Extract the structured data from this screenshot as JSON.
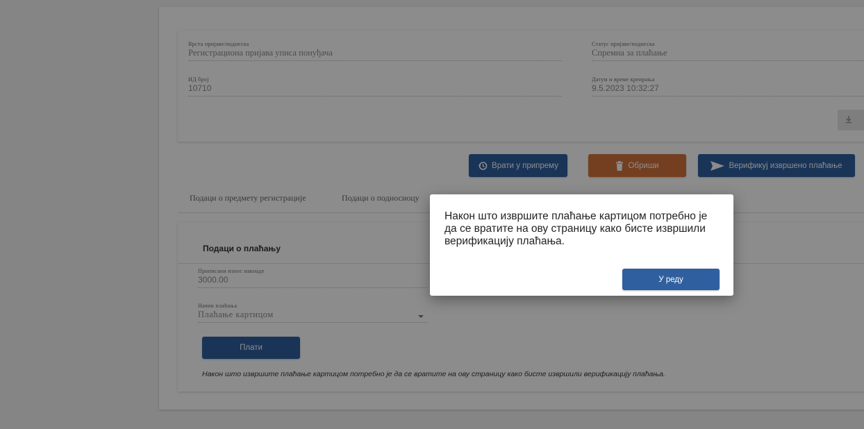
{
  "submission": {
    "type_label": "Врста пријаве/поднеска",
    "type_value": "Регистрациона пријава уписа понуђача",
    "status_label": "Статус пријаве/поднеска",
    "status_value": "Спремна за плаћање",
    "id_label": "ИД број",
    "id_value": "10710",
    "created_label": "Датум и време креирања",
    "created_value": "9.5.2023 10:32:27"
  },
  "actions": {
    "return_label": "Врати у припрему",
    "delete_label": "Обриши",
    "verify_label": "Верификуј извршено плаћање"
  },
  "tabs": [
    {
      "label": "Подаци о предмету регистрације"
    },
    {
      "label": "Подаци о подносиоцу"
    }
  ],
  "payment": {
    "title": "Подаци о плаћању",
    "fee_label": "Прописани износ накнаде",
    "fee_value": "3000.00",
    "method_label": "Начин плаћања",
    "method_value": "Плаћање картицом",
    "pay_button": "Плати",
    "note": "Након што извршите плаћање картицом потребно је да се вратите на ову страницу како бисте извршили верификацију плаћања."
  },
  "modal": {
    "message": "Након што извршите плаћање картицом потребно је да се вратите на ову страницу како бисте извршили верификацију плаћања.",
    "ok_label": "У реду"
  },
  "icons": {
    "download": "download-icon",
    "history": "history-icon",
    "trash": "trash-icon",
    "send": "send-icon",
    "dropdown": "caret-down-icon"
  },
  "colors": {
    "primary": "#2f5f9e",
    "danger": "#d4733d",
    "overlay": "rgba(0,0,0,0.45)"
  }
}
